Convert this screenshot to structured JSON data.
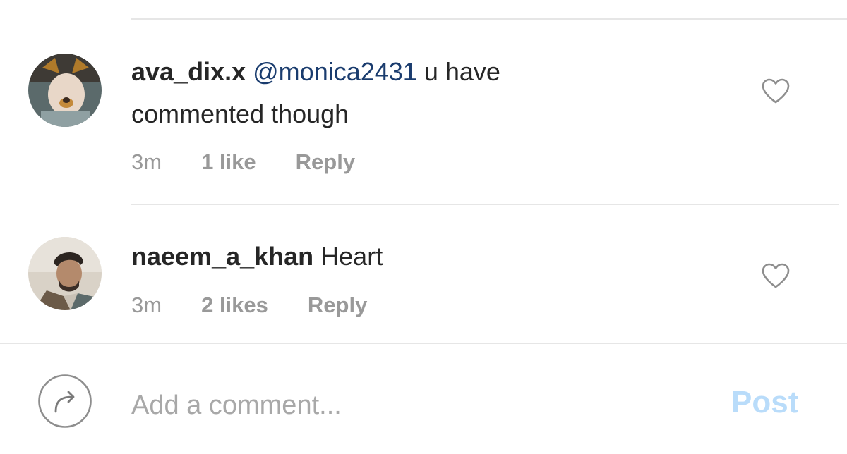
{
  "comments": [
    {
      "username": "ava_dix.x",
      "mention": "@monica2431",
      "text_line1": " u have",
      "text_line2": "commented though",
      "time": "3m",
      "likes": "1 like",
      "reply": "Reply"
    },
    {
      "username": "naeem_a_khan",
      "text": " Heart",
      "time": "3m",
      "likes": "2 likes",
      "reply": "Reply"
    }
  ],
  "composer": {
    "placeholder": "Add a comment...",
    "value": "",
    "post_label": "Post"
  },
  "colors": {
    "text": "#262626",
    "mention": "#1a3c6e",
    "meta": "#999999",
    "post_disabled": "#b9dcfa",
    "divider": "#e6e6e6"
  },
  "icons": {
    "like": "heart-outline-icon",
    "share": "share-arrow-icon"
  }
}
